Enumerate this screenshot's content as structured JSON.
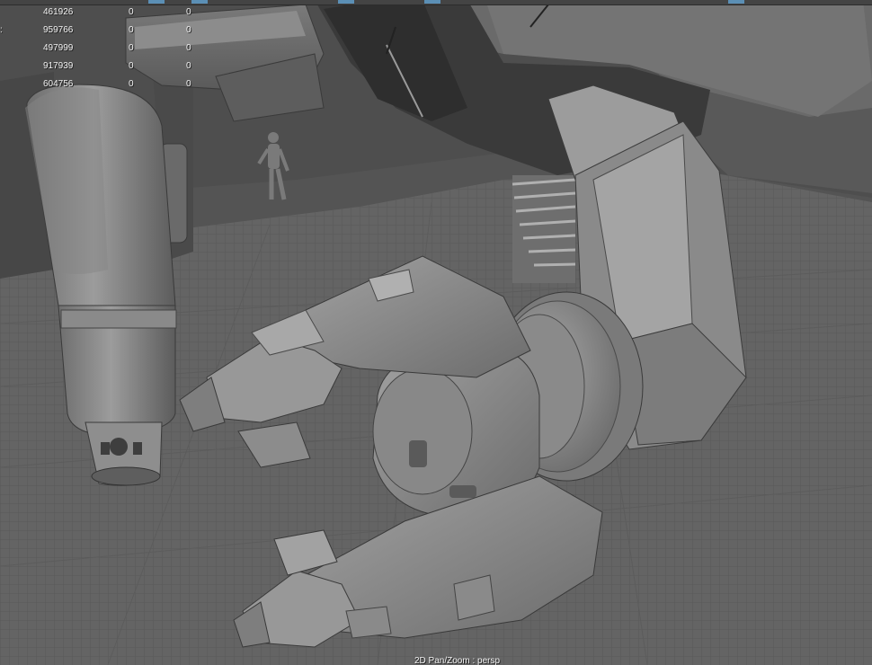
{
  "viewport": {
    "caption": "2D Pan/Zoom : persp"
  },
  "hud": {
    "rows": [
      {
        "prefix": "",
        "total": "461926",
        "selected": "0",
        "extra": "0"
      },
      {
        "prefix": ":",
        "total": "959766",
        "selected": "0",
        "extra": "0"
      },
      {
        "prefix": "",
        "total": "497999",
        "selected": "0",
        "extra": "0"
      },
      {
        "prefix": "",
        "total": "917939",
        "selected": "0",
        "extra": "0"
      },
      {
        "prefix": "",
        "total": "604756",
        "selected": "0",
        "extra": "0"
      }
    ]
  },
  "colors": {
    "background_far": "#4e4e4e",
    "ground": "#646464",
    "grid_line": "#575757",
    "model_light": "#9a9a9a",
    "model_mid": "#7e7e7e",
    "model_dark": "#3c3c3c",
    "accent_marker": "#5b8fb5",
    "hud_text": "#f2f2f2"
  },
  "icons": {
    "character": "humanoid-reference-figure"
  }
}
